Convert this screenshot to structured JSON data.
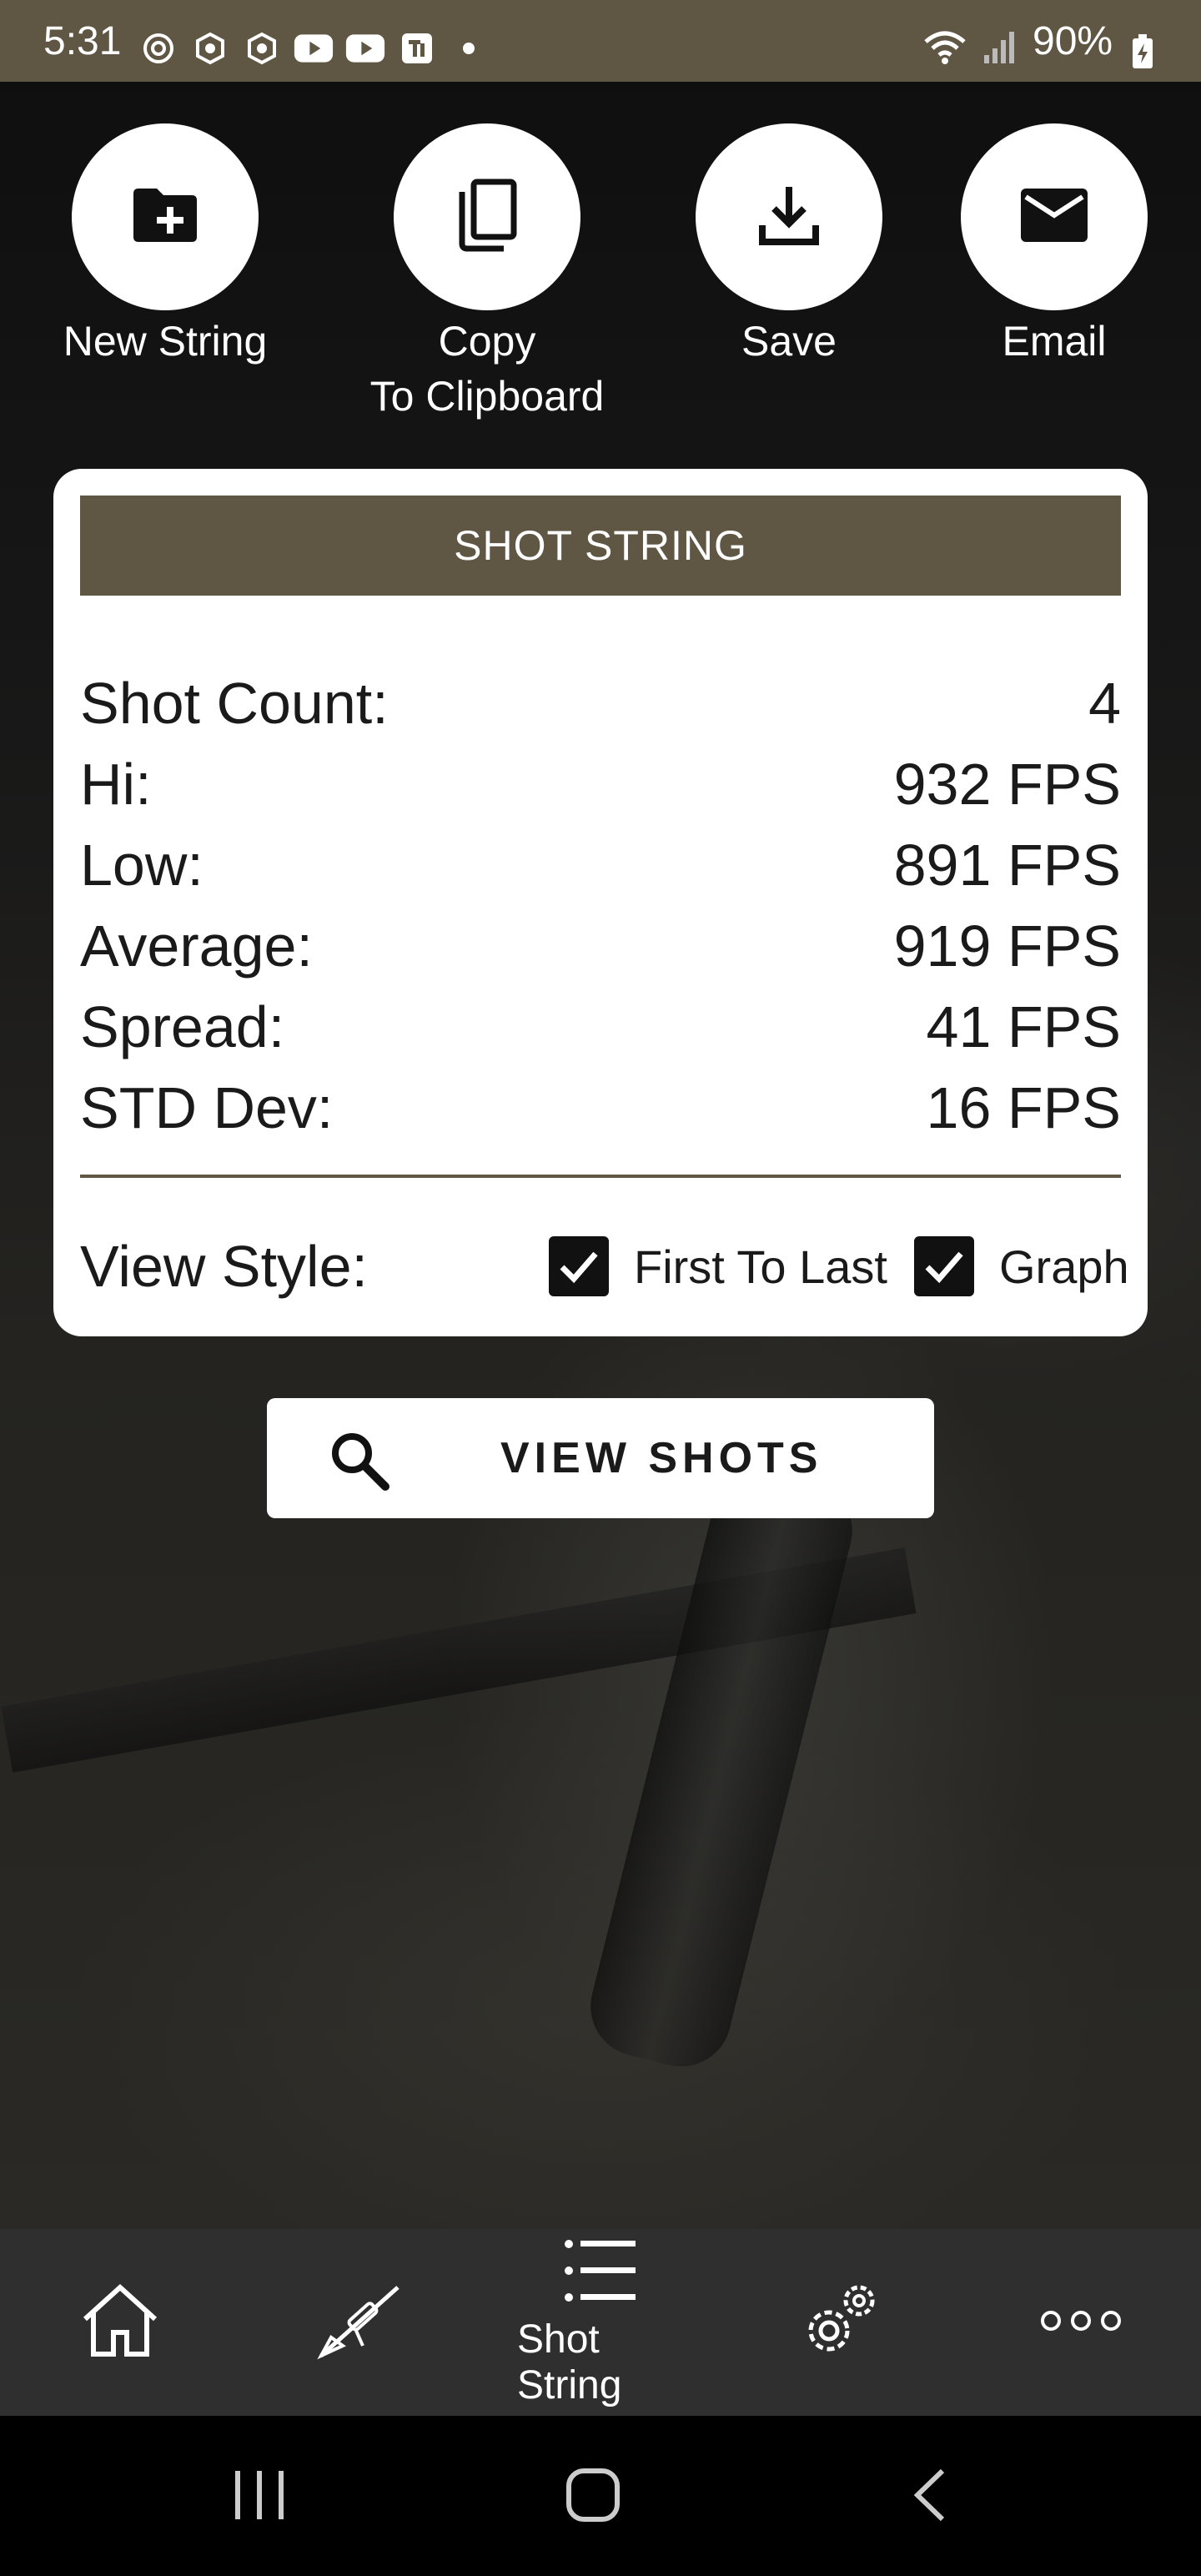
{
  "status_bar": {
    "time": "5:31",
    "battery": "90%",
    "notification_icons": [
      "threads-icon",
      "openai-icon",
      "openai-icon",
      "youtube-icon",
      "youtube-icon",
      "tiktok-icon",
      "dot-icon"
    ]
  },
  "actions": [
    {
      "label": "New String",
      "icon": "new-folder-icon"
    },
    {
      "label": "Copy\nTo Clipboard",
      "icon": "copy-icon"
    },
    {
      "label": "Save",
      "icon": "download-icon"
    },
    {
      "label": "Email",
      "icon": "mail-icon"
    }
  ],
  "card": {
    "header": "SHOT STRING",
    "stats": [
      {
        "label": "Shot Count:",
        "value": "4"
      },
      {
        "label": "Hi:",
        "value": "932 FPS"
      },
      {
        "label": "Low:",
        "value": "891 FPS"
      },
      {
        "label": "Average:",
        "value": "919 FPS"
      },
      {
        "label": "Spread:",
        "value": "41 FPS"
      },
      {
        "label": "STD Dev:",
        "value": "16 FPS"
      }
    ],
    "view_style": {
      "label": "View Style:",
      "options": [
        {
          "label": "First To Last",
          "checked": true
        },
        {
          "label": "Graph",
          "checked": true
        }
      ]
    }
  },
  "view_shots_button": {
    "label": "VIEW SHOTS",
    "icon": "search-icon"
  },
  "bottom_nav": {
    "items": [
      {
        "icon": "home-icon",
        "label": ""
      },
      {
        "icon": "rifle-icon",
        "label": ""
      },
      {
        "icon": "list-icon",
        "label": "Shot String",
        "active": true
      },
      {
        "icon": "settings-icon",
        "label": ""
      },
      {
        "icon": "more-icon",
        "label": ""
      }
    ]
  },
  "colors": {
    "brand": "#5f5644",
    "nav_background": "#2f2f2f",
    "card_background": "#ffffff"
  }
}
